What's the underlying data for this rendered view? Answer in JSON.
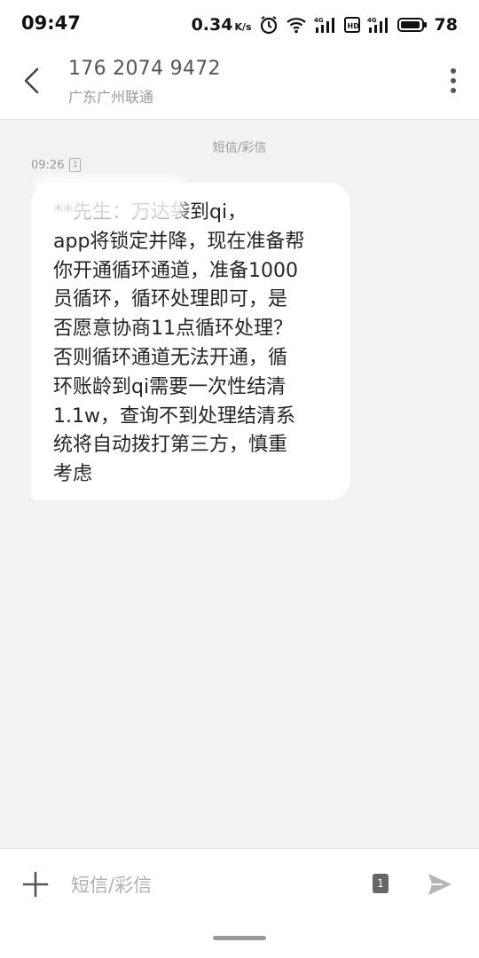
{
  "status_bar": {
    "time": "09:47",
    "net_speed": "0.34",
    "net_unit": "K/s",
    "battery": "78"
  },
  "header": {
    "contact_number": "176 2074 9472",
    "contact_region": "广东广州联通"
  },
  "conversation": {
    "type_label": "短信/彩信",
    "message": {
      "time": "09:26",
      "sim": "1",
      "text": "**先生：万达袋到qi，\napp将锁定并降，现在准备帮\n你开通循环通道，准备1000\n员循环，循环处理即可，是\n否愿意协商11点循环处理？\n否则循环通道无法开通，循\n环账龄到qi需要一次性结清\n1.1w，查询不到处理结清系\n统将自动拨打第三方，慎重\n考虑"
    }
  },
  "input_bar": {
    "placeholder": "短信/彩信",
    "sim": "1"
  },
  "colors": {
    "background": "#f2f2f2",
    "bubble": "#ffffff",
    "header": "#ffffff",
    "secondary_text": "#9b9b9b"
  }
}
